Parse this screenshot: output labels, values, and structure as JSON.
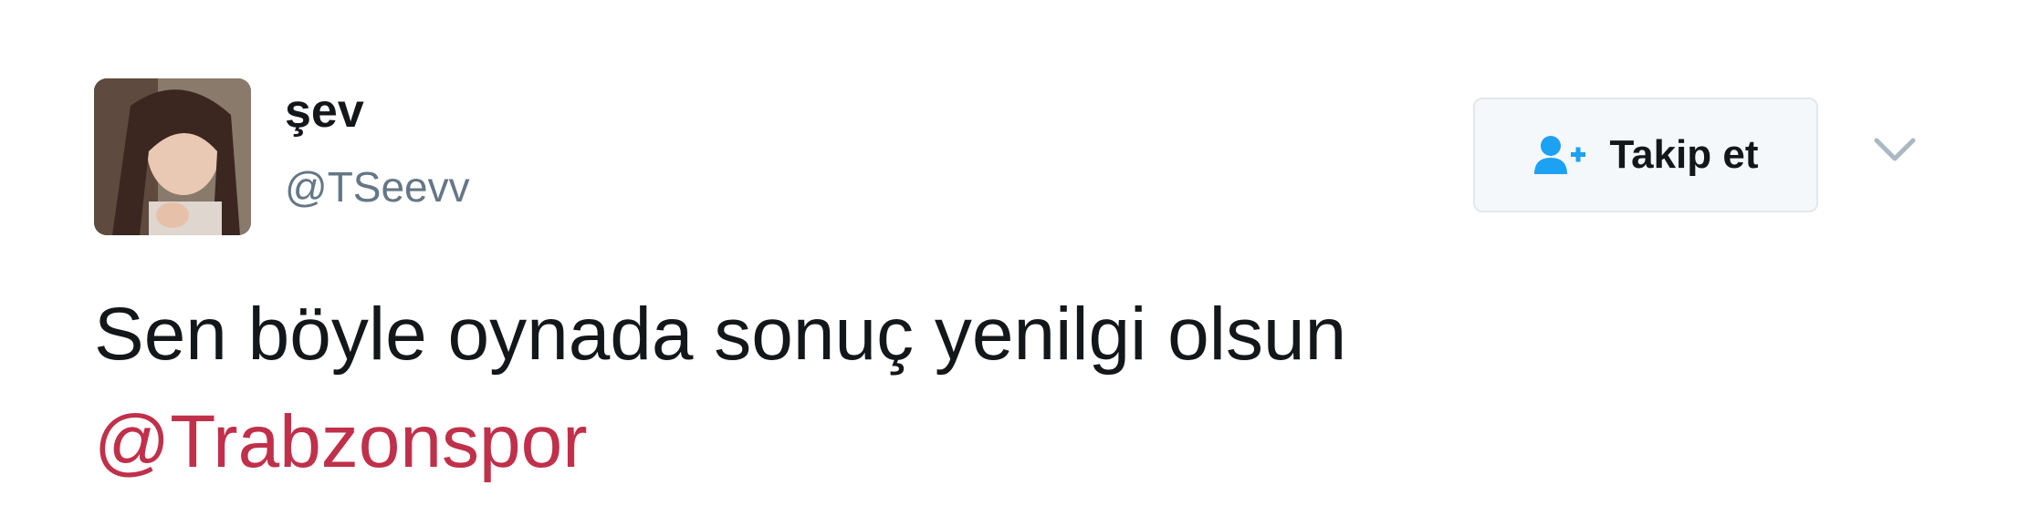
{
  "tweet": {
    "author": {
      "display_name": "şev",
      "handle": "@TSeevv"
    },
    "follow_button_label": "Takip et",
    "text": "Sen böyle oynada sonuç yenilgi olsun",
    "mention": "@Trabzonspor"
  },
  "colors": {
    "accent_blue": "#1da1f2",
    "mention_red": "#c0304a",
    "handle_gray": "#657786"
  },
  "icons": {
    "follow": "person-plus-icon",
    "more": "chevron-down-icon"
  }
}
